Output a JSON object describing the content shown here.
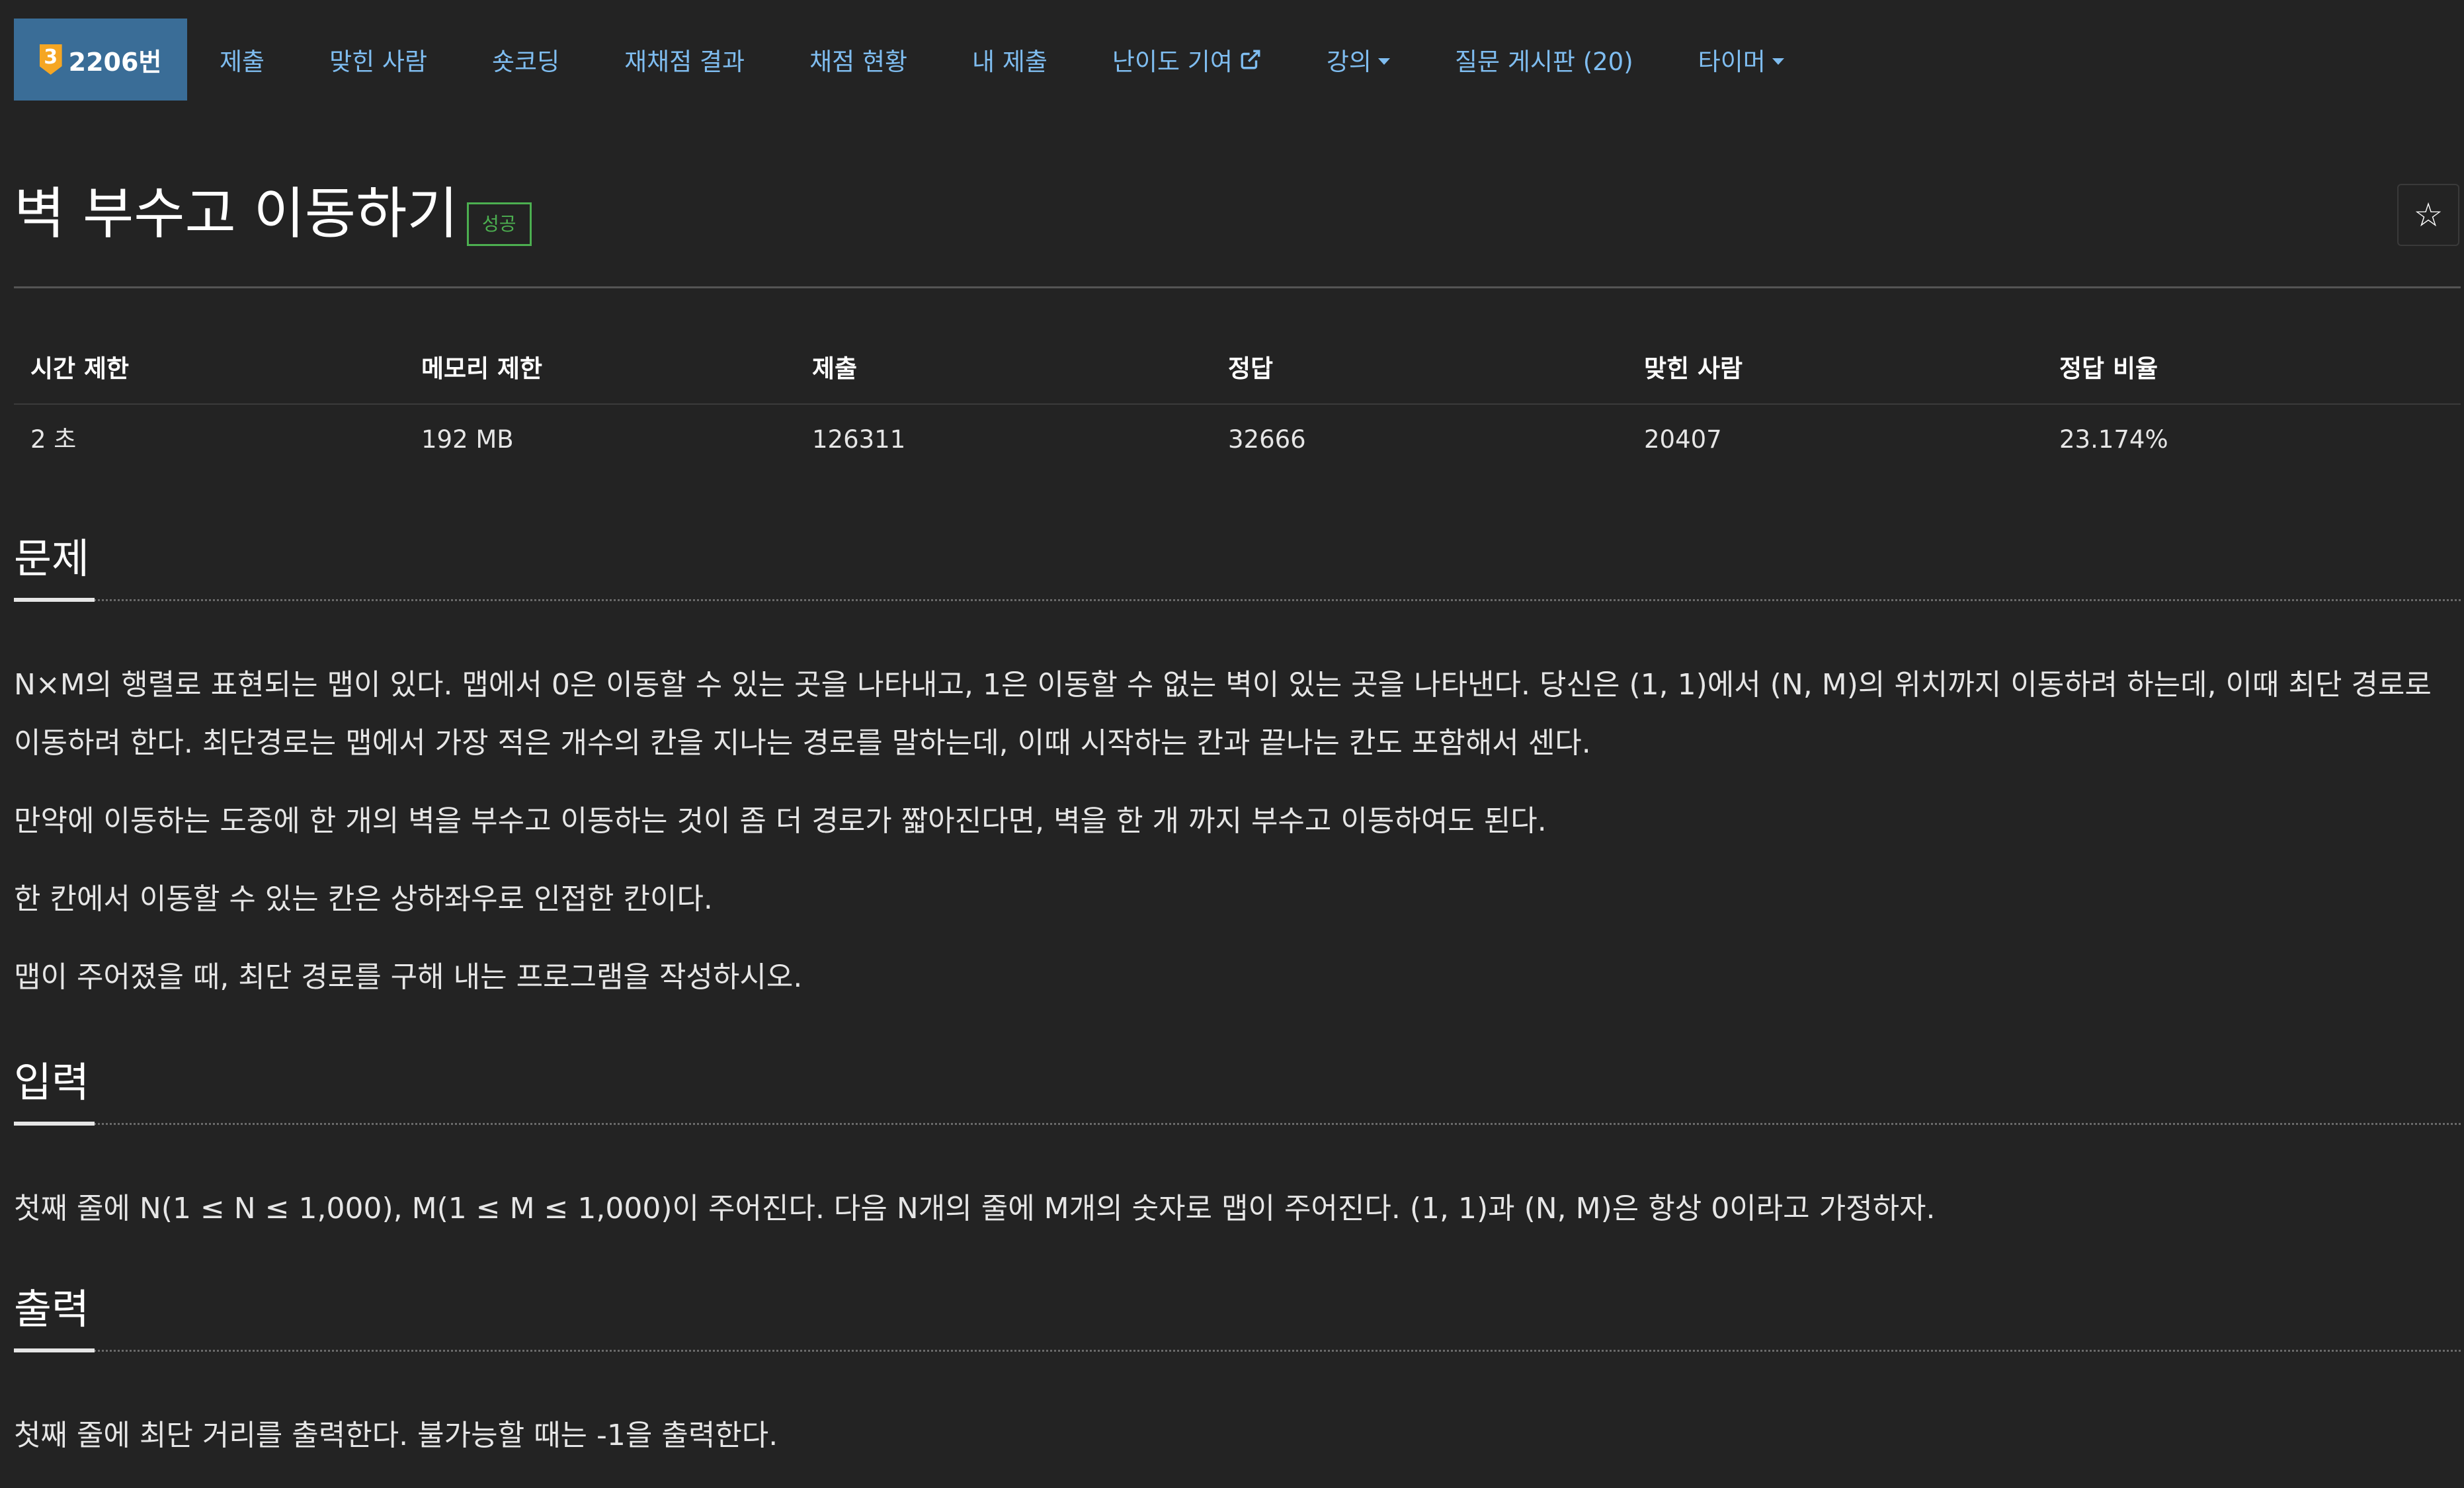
{
  "nav": {
    "tier_badge": "3",
    "problem_number": "2206번",
    "items": [
      {
        "label": "제출"
      },
      {
        "label": "맞힌 사람"
      },
      {
        "label": "숏코딩"
      },
      {
        "label": "재채점 결과"
      },
      {
        "label": "채점 현황"
      },
      {
        "label": "내 제출"
      },
      {
        "label": "난이도 기여"
      },
      {
        "label": "강의"
      },
      {
        "label": "질문 게시판 (20)"
      },
      {
        "label": "타이머"
      }
    ]
  },
  "problem": {
    "title": "벽 부수고 이동하기",
    "status": "성공",
    "star_icon": "☆"
  },
  "stats": {
    "headers": [
      "시간 제한",
      "메모리 제한",
      "제출",
      "정답",
      "맞힌 사람",
      "정답 비율"
    ],
    "values": [
      "2 초",
      "192 MB",
      "126311",
      "32666",
      "20407",
      "23.174%"
    ]
  },
  "sections": {
    "description": {
      "title": "문제",
      "paragraphs": [
        "N×M의 행렬로 표현되는 맵이 있다. 맵에서 0은 이동할 수 있는 곳을 나타내고, 1은 이동할 수 없는 벽이 있는 곳을 나타낸다. 당신은 (1, 1)에서 (N, M)의 위치까지 이동하려 하는데, 이때 최단 경로로 이동하려 한다. 최단경로는 맵에서 가장 적은 개수의 칸을 지나는 경로를 말하는데, 이때 시작하는 칸과 끝나는 칸도 포함해서 센다.",
        "만약에 이동하는 도중에 한 개의 벽을 부수고 이동하는 것이 좀 더 경로가 짧아진다면, 벽을 한 개 까지 부수고 이동하여도 된다.",
        "한 칸에서 이동할 수 있는 칸은 상하좌우로 인접한 칸이다.",
        "맵이 주어졌을 때, 최단 경로를 구해 내는 프로그램을 작성하시오."
      ]
    },
    "input": {
      "title": "입력",
      "paragraphs": [
        "첫째 줄에 N(1 ≤ N ≤ 1,000), M(1 ≤ M ≤ 1,000)이 주어진다. 다음 N개의 줄에 M개의 숫자로 맵이 주어진다. (1, 1)과 (N, M)은 항상 0이라고 가정하자."
      ]
    },
    "output": {
      "title": "출력",
      "paragraphs": [
        "첫째 줄에 최단 거리를 출력한다. 불가능할 때는 -1을 출력한다."
      ]
    }
  },
  "colors": {
    "background": "#232323",
    "nav_active": "#3a6d97",
    "link": "#7fbdf0",
    "success": "#4caf50",
    "tier_gold": "#f5a623"
  }
}
